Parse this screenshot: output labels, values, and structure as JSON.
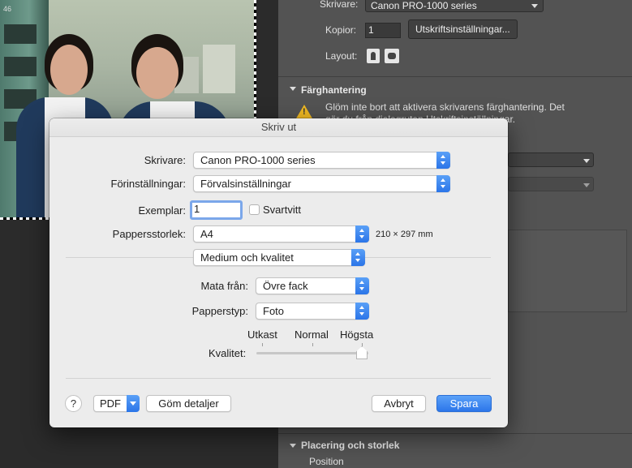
{
  "ps_panel": {
    "printer_label": "Skrivare:",
    "printer_value": "Canon PRO-1000 series",
    "copies_label": "Kopior:",
    "copies_value": "1",
    "print_settings_button": "Utskriftsinställningar...",
    "layout_label": "Layout:",
    "color_section": "Färghantering",
    "warning_line1": "Glöm inte bort att aktivera skrivarens färghantering. Det",
    "warning_line2": "gör du från dialogrutan Utskriftsinställningar.",
    "placement_section": "Placering och storlek",
    "position_label": "Position"
  },
  "dialog": {
    "title": "Skriv ut",
    "printer_label": "Skrivare:",
    "printer_value": "Canon PRO-1000 series",
    "presets_label": "Förinställningar:",
    "presets_value": "Förvalsinställningar",
    "copies_label": "Exemplar:",
    "copies_value": "1",
    "bw_label": "Svartvitt",
    "paper_size_label": "Pappersstorlek:",
    "paper_size_value": "A4",
    "paper_dims": "210 × 297 mm",
    "section_value": "Medium och kvalitet",
    "feed_label": "Mata från:",
    "feed_value": "Övre fack",
    "media_label": "Papperstyp:",
    "media_value": "Foto",
    "quality_label": "Kvalitet:",
    "quality_levels": [
      "Utkast",
      "Normal",
      "Högsta"
    ],
    "quality_level": 1.0,
    "help_label": "?",
    "pdf_label": "PDF",
    "hide_details_button": "Göm detaljer",
    "cancel_button": "Avbryt",
    "save_button": "Spara"
  },
  "photo": {
    "train_number": "46"
  }
}
